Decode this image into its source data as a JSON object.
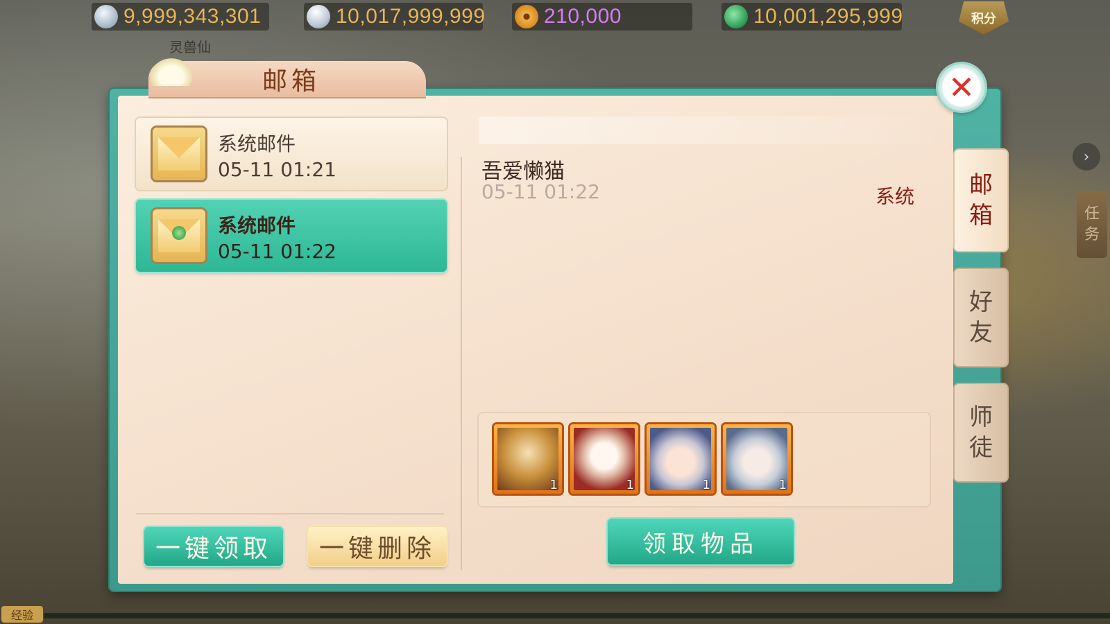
{
  "currencies": [
    {
      "icon": "lingyu-currency-icon",
      "value": "9,999,343,301",
      "color": "#e7b45a"
    },
    {
      "icon": "silver-ingot-icon",
      "value": "10,017,999,999",
      "color": "#e7b45a"
    },
    {
      "icon": "copper-coin-icon",
      "value": "210,000",
      "color": "#d77cf0"
    },
    {
      "icon": "jade-add-icon",
      "value": "10,001,295,999",
      "color": "#e7b45a"
    }
  ],
  "score_badge": "积分",
  "caption": "灵兽仙",
  "window": {
    "title": "邮箱"
  },
  "mail_list": [
    {
      "title": "系统邮件",
      "time": "05-11  01:21",
      "selected": false
    },
    {
      "title": "系统邮件",
      "time": "05-11  01:22",
      "selected": true
    }
  ],
  "buttons": {
    "claim_all": "一键领取",
    "delete_all": "一键删除",
    "receive_items": "领取物品"
  },
  "detail": {
    "sender": "吾爱懒猫",
    "time": "05-11  01:22",
    "from": "系统",
    "attachments": [
      {
        "qty": "1"
      },
      {
        "qty": "1"
      },
      {
        "qty": "1"
      },
      {
        "qty": "1"
      }
    ]
  },
  "side_tabs": [
    {
      "label_1": "邮",
      "label_2": "箱",
      "active": true
    },
    {
      "label_1": "好",
      "label_2": "友",
      "active": false
    },
    {
      "label_1": "师",
      "label_2": "徒",
      "active": false
    }
  ],
  "task_tab": {
    "label_1": "任",
    "label_2": "务"
  },
  "exp_label": "经验",
  "colors": {
    "accent": "#2eb795",
    "title_red": "#8a1c12",
    "close_red": "#e0322a"
  }
}
